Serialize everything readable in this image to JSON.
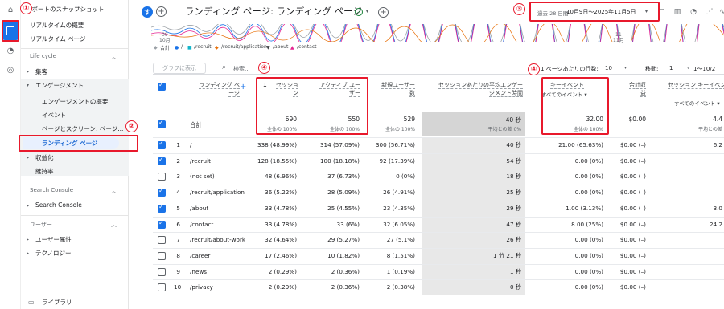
{
  "sidebar": {
    "snapshot": "レポートのスナップショット",
    "realtime_overview": "リアルタイムの概要",
    "realtime_pages": "リアルタイム ページ",
    "lifecycle": "Life cycle",
    "acquisition": "集客",
    "engagement": "エンゲージメント",
    "engagement_overview": "エンゲージメントの概要",
    "events": "イベント",
    "pages_screens": "ページとスクリーン: ページ...",
    "landing_page": "ランディング ページ",
    "monetization": "収益化",
    "retention": "維持率",
    "search_console_section": "Search Console",
    "search_console": "Search Console",
    "users_section": "ユーザー",
    "user_attributes": "ユーザー属性",
    "technology": "テクノロジー",
    "library": "ライブラリ"
  },
  "header": {
    "avatar": "す",
    "title": "ランディング ページ: ランディング ページ",
    "date_label": "過去 28 日間",
    "date_range": "10月9日～2025年11月5日"
  },
  "chart": {
    "x_labels": [
      {
        "day": "09",
        "month": "10月"
      },
      {
        "day": "11",
        "month": "11月"
      }
    ],
    "legend": [
      "合計",
      "/",
      "/recruit",
      "/recruit/application",
      "/about",
      "/contact"
    ]
  },
  "colors": {
    "total": "#9aa0a6",
    "root": "#1a73e8",
    "recruit": "#12b5cb",
    "application": "#e8710a",
    "about": "#3c4043",
    "contact": "#e52592",
    "annotation": "#e8192c"
  },
  "toolbar": {
    "graph_button": "グラフに表示",
    "search_placeholder": "検索...",
    "rows_per_page_label": "1 ページあたりの行数:",
    "rows_per_page": "10",
    "goto_label": "移動:",
    "goto_page": "1",
    "pagination": "1～10/2"
  },
  "annotations": [
    "①",
    "②",
    "③",
    "④",
    "④"
  ],
  "table": {
    "headers": {
      "landing_page": [
        "ランディング ペ",
        "ージ"
      ],
      "sessions": [
        "セッショ",
        "ン"
      ],
      "active_users": [
        "アクティブ ユー",
        "ザー"
      ],
      "new_users": [
        "新規ユーザー",
        "数"
      ],
      "avg_time": [
        "セッションあたりの平均エンゲー",
        "ジメント時間"
      ],
      "key_events": [
        "キーイベント",
        "すべてのイベント"
      ],
      "revenue": [
        "合計収",
        "益"
      ],
      "session_key": [
        "セッション キーイベン",
        "すべてのイベント"
      ]
    },
    "total": {
      "label": "合計",
      "sessions": "690",
      "sessions_sub": "全体の 100%",
      "active": "550",
      "active_sub": "全体の 100%",
      "new": "529",
      "new_sub": "全体の 100%",
      "time": "40 秒",
      "time_sub": "平均との差 0%",
      "key": "32.00",
      "key_sub": "全体の 100%",
      "revenue": "$0.00",
      "skey": "4.4",
      "skey_sub": "平均との差"
    },
    "rows": [
      {
        "n": "1",
        "checked": true,
        "page": "/",
        "sessions": "338 (48.99%)",
        "active": "314 (57.09%)",
        "new": "300 (56.71%)",
        "time": "40 秒",
        "key": "21.00 (65.63%)",
        "rev": "$0.00 (–)",
        "skey": "6.2"
      },
      {
        "n": "2",
        "checked": true,
        "page": "/recruit",
        "sessions": "128 (18.55%)",
        "active": "100 (18.18%)",
        "new": "92 (17.39%)",
        "time": "54 秒",
        "key": "0.00 (0%)",
        "rev": "$0.00 (–)",
        "skey": ""
      },
      {
        "n": "3",
        "checked": false,
        "page": "(not set)",
        "sessions": "48 (6.96%)",
        "active": "37 (6.73%)",
        "new": "0 (0%)",
        "time": "18 秒",
        "key": "0.00 (0%)",
        "rev": "$0.00 (–)",
        "skey": ""
      },
      {
        "n": "4",
        "checked": true,
        "page": "/recruit/application",
        "sessions": "36 (5.22%)",
        "active": "28 (5.09%)",
        "new": "26 (4.91%)",
        "time": "25 秒",
        "key": "0.00 (0%)",
        "rev": "$0.00 (–)",
        "skey": ""
      },
      {
        "n": "5",
        "checked": true,
        "page": "/about",
        "sessions": "33 (4.78%)",
        "active": "25 (4.55%)",
        "new": "23 (4.35%)",
        "time": "29 秒",
        "key": "1.00 (3.13%)",
        "rev": "$0.00 (–)",
        "skey": "3.0"
      },
      {
        "n": "6",
        "checked": true,
        "page": "/contact",
        "sessions": "33 (4.78%)",
        "active": "33 (6%)",
        "new": "32 (6.05%)",
        "time": "47 秒",
        "key": "8.00 (25%)",
        "rev": "$0.00 (–)",
        "skey": "24.2"
      },
      {
        "n": "7",
        "checked": false,
        "page": "/recruit/about-work",
        "sessions": "32 (4.64%)",
        "active": "29 (5.27%)",
        "new": "27 (5.1%)",
        "time": "26 秒",
        "key": "0.00 (0%)",
        "rev": "$0.00 (–)",
        "skey": ""
      },
      {
        "n": "8",
        "checked": false,
        "page": "/career",
        "sessions": "17 (2.46%)",
        "active": "10 (1.82%)",
        "new": "8 (1.51%)",
        "time": "1 分 21 秒",
        "key": "0.00 (0%)",
        "rev": "$0.00 (–)",
        "skey": ""
      },
      {
        "n": "9",
        "checked": false,
        "page": "/news",
        "sessions": "2 (0.29%)",
        "active": "2 (0.36%)",
        "new": "1 (0.19%)",
        "time": "1 秒",
        "key": "0.00 (0%)",
        "rev": "$0.00 (–)",
        "skey": ""
      },
      {
        "n": "10",
        "checked": false,
        "page": "/privacy",
        "sessions": "2 (0.29%)",
        "active": "2 (0.36%)",
        "new": "2 (0.38%)",
        "time": "0 秒",
        "key": "0.00 (0%)",
        "rev": "$0.00 (–)",
        "skey": ""
      }
    ]
  }
}
